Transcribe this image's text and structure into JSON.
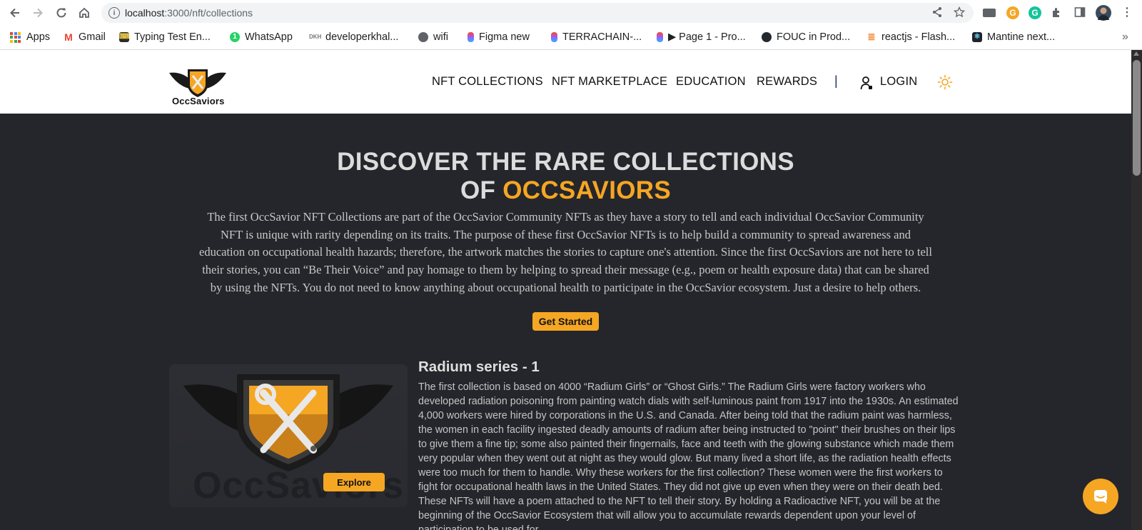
{
  "browser": {
    "url_host": "localhost",
    "url_path": ":3000/nft/collections",
    "bookmarks": [
      {
        "label": "Apps",
        "icon": "apps-grid-icon"
      },
      {
        "label": "Gmail",
        "icon": "gmail-icon"
      },
      {
        "label": "Typing Test En...",
        "icon": "typing-test-icon"
      },
      {
        "label": "WhatsApp",
        "icon": "whatsapp-icon"
      },
      {
        "label": "developerkhal...",
        "icon": "developer-icon"
      },
      {
        "label": "wifi",
        "icon": "globe-icon"
      },
      {
        "label": "Figma new",
        "icon": "figma-icon"
      },
      {
        "label": "TERRACHAIN-...",
        "icon": "figma-icon"
      },
      {
        "label": "▶ Page 1 - Pro...",
        "icon": "figma-icon"
      },
      {
        "label": "FOUC in Prod...",
        "icon": "github-icon"
      },
      {
        "label": "reactjs - Flash...",
        "icon": "stackoverflow-icon"
      },
      {
        "label": "Mantine next...",
        "icon": "react-icon"
      }
    ]
  },
  "header": {
    "logo_text": "OccSaviors",
    "nav": [
      {
        "label": "NFT COLLECTIONS"
      },
      {
        "label": "NFT MARKETPLACE"
      },
      {
        "label": "EDUCATION"
      },
      {
        "label": "REWARDS"
      }
    ],
    "separator": "|",
    "login_label": "LOGIN"
  },
  "hero": {
    "title_line1": "DISCOVER THE RARE COLLECTIONS",
    "title_line2_prefix": "OF ",
    "title_line2_accent": "OCCSAVIORS",
    "description": "The first OccSavior NFT Collections are part of the OccSavior Community NFTs as they have a story to tell and each individual OccSavior Community NFT is unique with rarity depending on its traits. The purpose of these first OccSavior NFTs is to help build a community to spread awareness and education on occupational health hazards; therefore, the artwork matches the stories to capture one's attention. Since the first OccSaviors are not here to tell their stories, you can “Be Their Voice” and pay homage to them by helping to spread their message (e.g., poem or health exposure data) that can be shared by using the NFTs. You do not need to know anything about occupational health to participate in the OccSavior ecosystem. Just a desire to help others.",
    "cta_label": "Get Started"
  },
  "collection": {
    "watermark": "OccSaviors",
    "explore_label": "Explore",
    "title": "Radium series - 1",
    "description": "The first collection is based on 4000 “Radium Girls” or “Ghost Girls.” The Radium Girls were factory workers who developed radiation poisoning from painting watch dials with self-luminous paint from 1917 into the 1930s. An estimated 4,000 workers were hired by corporations in the U.S. and Canada. After being told that the radium paint was harmless, the women in each facility ingested deadly amounts of radium after being instructed to \"point\" their brushes on their lips to give them a fine tip; some also painted their fingernails, face and teeth with the glowing substance which made them very popular when they went out at night as they would glow. But many lived a short life, as the radiation health effects were too much for them to handle. Why these workers for the first collection? These women were the first workers to fight for occupational health laws in the United States. They did not give up even when they were on their death bed. These NFTs will have a poem attached to the NFT to tell their story. By holding a Radioactive NFT, you will be at the beginning of the OccSavior Ecosystem that will allow you to accumulate rewards dependent upon your level of participation to be used for"
  },
  "colors": {
    "accent": "#f5a623",
    "background": "#25262b",
    "nav_separator": "#1c2d6b"
  }
}
